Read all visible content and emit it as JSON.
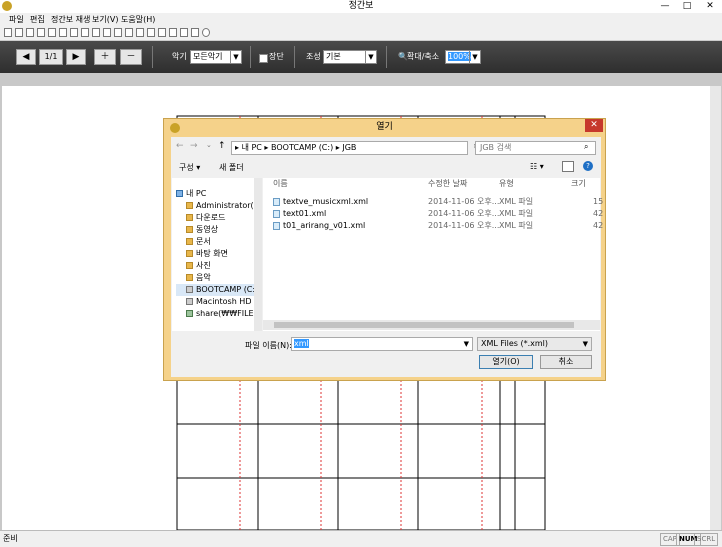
{
  "window": {
    "title": "정간보",
    "minimize_glyph": "—",
    "maximize_glyph": "□",
    "close_glyph": "✕"
  },
  "menu": [
    "파일",
    "편집",
    "정간보 재생",
    "보기(V)",
    "도움말(H)"
  ],
  "toolbar": {
    "page_indicator": "1/1",
    "instrument_label": "악기",
    "instrument_value": "모든악기",
    "jangdan_label": "장단",
    "jo_label": "조성",
    "jo_value": "기본",
    "zoom_label": "확대/축소",
    "zoom_value": "100%"
  },
  "dialog": {
    "title": "열기",
    "address": [
      "내 PC",
      "BOOTCAMP (C:)",
      "JGB"
    ],
    "search_placeholder": "JGB 검색",
    "organize": "구성 ▾",
    "new_folder": "새 폴더",
    "nav_items": [
      {
        "label": "내 PC",
        "icon": "pc-icon"
      },
      {
        "label": "Administrator(m",
        "icon": "folder-icon"
      },
      {
        "label": "다운로드",
        "icon": "folder-icon"
      },
      {
        "label": "동영상",
        "icon": "folder-icon"
      },
      {
        "label": "문서",
        "icon": "folder-icon"
      },
      {
        "label": "바탕 화면",
        "icon": "folder-icon"
      },
      {
        "label": "사진",
        "icon": "folder-icon"
      },
      {
        "label": "음악",
        "icon": "folder-icon"
      },
      {
        "label": "BOOTCAMP (C:)",
        "icon": "drive-icon"
      },
      {
        "label": "Macintosh HD (I",
        "icon": "drive-icon"
      },
      {
        "label": "share(₩₩FILESEF",
        "icon": "network-drive-icon"
      }
    ],
    "columns": {
      "name": "이름",
      "date": "수정한 날짜",
      "type": "유형",
      "size": "크기"
    },
    "files": [
      {
        "name": "textve_musicxml.xml",
        "date": "2014-11-06 오후...",
        "type": "XML 파일",
        "size": "15"
      },
      {
        "name": "text01.xml",
        "date": "2014-11-06 오후...",
        "type": "XML 파일",
        "size": "42"
      },
      {
        "name": "t01_arirang_v01.xml",
        "date": "2014-11-06 오후...",
        "type": "XML 파일",
        "size": "42"
      }
    ],
    "filename_label": "파일 이름(N):",
    "filename_value": "xml",
    "filetype_value": "XML Files (*.xml)",
    "open_button": "열기(O)",
    "cancel_button": "취소"
  },
  "status": {
    "left": "준비",
    "cap": "CAP",
    "num": "NUM",
    "scrl": "SCRL"
  },
  "colors": {
    "dialog_frame": "#f5d28a",
    "close_red": "#c6382c",
    "selection_blue": "#3399ff",
    "dark_toolbar": "#3a3a3a"
  }
}
